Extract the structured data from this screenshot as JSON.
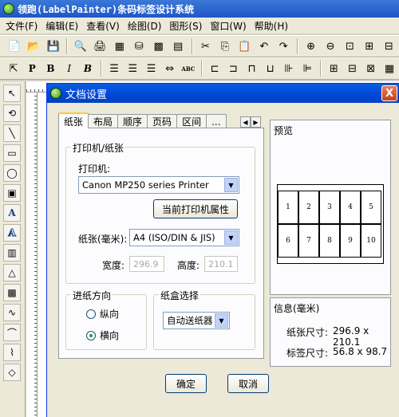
{
  "app": {
    "title": "领跑(LabelPainter)条码标签设计系统"
  },
  "menu": [
    "文件(F)",
    "编辑(E)",
    "查看(V)",
    "绘图(D)",
    "图形(S)",
    "窗口(W)",
    "帮助(H)"
  ],
  "toolbar2_text": {
    "bold": "P",
    "italic_b": "B",
    "italic": "I",
    "bold_italic": "B",
    "abc": "ABC"
  },
  "left_tools": {
    "text_a": "A",
    "outline_a": "A"
  },
  "dialog": {
    "title": "文档设置",
    "close": "X",
    "tabs": [
      "纸张",
      "布局",
      "顺序",
      "页码",
      "区间",
      "..."
    ],
    "printer_group": {
      "legend": "打印机/纸张",
      "printer_label": "打印机:",
      "printer_value": "Canon MP250 series Printer",
      "printer_props_button": "当前打印机属性",
      "paper_label": "纸张(毫米):",
      "paper_value": "A4 (ISO/DIN & JIS)",
      "width_label": "宽度:",
      "width_value": "296.9",
      "height_label": "高度:",
      "height_value": "210.1"
    },
    "feed_group": {
      "legend": "进纸方向",
      "portrait": "纵向",
      "landscape": "横向",
      "selected": "landscape"
    },
    "tray_group": {
      "legend": "纸盒选择",
      "value": "自动送纸器"
    },
    "preview": {
      "title": "预览",
      "cells": [
        "1",
        "2",
        "3",
        "4",
        "5",
        "6",
        "7",
        "8",
        "9",
        "10"
      ]
    },
    "info": {
      "title": "信息(毫米)",
      "paper_size_label": "纸张尺寸:",
      "paper_size_value": "296.9 x 210.1",
      "label_size_label": "标签尺寸:",
      "label_size_value": "56.8 x 98.7"
    },
    "ok_button": "确定",
    "cancel_button": "取消"
  },
  "colors": {
    "title_bar": "#0a5fe0",
    "dialog_bg": "#ece9d8",
    "close_button": "#c3421c"
  }
}
